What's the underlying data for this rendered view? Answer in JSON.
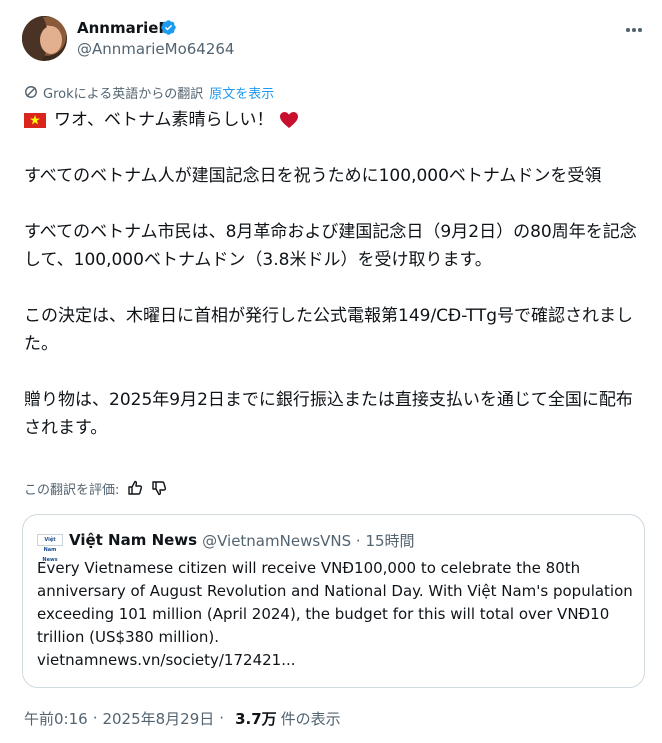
{
  "author": {
    "display_name": "AnnmarieF",
    "handle": "@AnnmarieMo64264"
  },
  "translation": {
    "note": "Grokによる英語からの翻訳",
    "show_original": "原文を表示",
    "rate_label": "この翻訳を評価:"
  },
  "tweet": {
    "line1": "ワオ、ベトナム素晴らしい！",
    "para2": "すべてのベトナム人が建国記念日を祝うために100,000ベトナムドンを受領",
    "para3": "すべてのベトナム市民は、8月革命および建国記念日（9月2日）の80周年を記念して、100,000ベトナムドン（3.8米ドル）を受け取ります。",
    "para4": "この決定は、木曜日に首相が発行した公式電報第149/CĐ-TTg号で確認されました。",
    "para5": "贈り物は、2025年9月2日までに銀行振込または直接支払いを通じて全国に配布されます。"
  },
  "quote": {
    "logo_text": "Việt Nam News",
    "name": "Việt Nam News",
    "handle": "@VietnamNewsVNS · 15時間",
    "body": "Every Vietnamese citizen will receive VNĐ100,000 to celebrate the 80th anniversary of August Revolution and National Day. With Việt Nam's population exceeding 101 million (April 2024), the budget for this will total over VNĐ10 trillion (US$380 million).",
    "link": "vietnamnews.vn/society/172421..."
  },
  "meta": {
    "time": "午前0:16",
    "date": "2025年8月29日",
    "views_count": "3.7万",
    "views_label": "件の表示"
  },
  "colors": {
    "accent": "#1d9bf0",
    "secondary_text": "#536471",
    "flag_red": "#da251d",
    "flag_star": "#ffff00",
    "heart": "#c8102e"
  },
  "icons": [
    "verified-badge-icon",
    "more-icon",
    "grok-translate-icon",
    "vietnam-flag-icon",
    "red-heart-icon",
    "thumbs-up-icon",
    "thumbs-down-icon"
  ]
}
